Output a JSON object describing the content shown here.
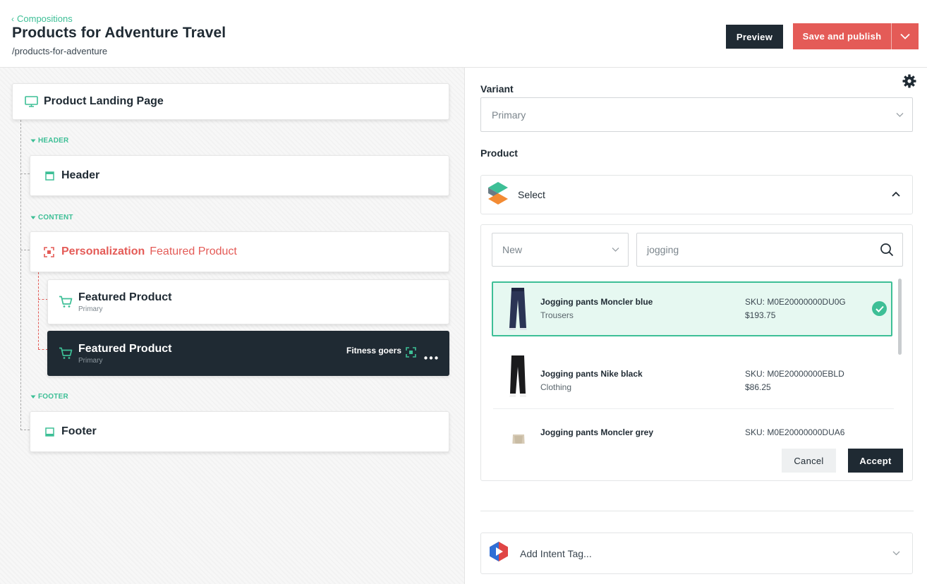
{
  "header": {
    "back_label": "Compositions",
    "title": "Products for Adventure Travel",
    "slug": "/products-for-adventure",
    "preview_label": "Preview",
    "publish_label": "Save and publish"
  },
  "tree": {
    "root": "Product Landing Page",
    "sections": {
      "header": "HEADER",
      "content": "CONTENT",
      "footer": "FOOTER"
    },
    "header_component": "Header",
    "personalization": {
      "label": "Personalization",
      "name": "Featured Product"
    },
    "variants": [
      {
        "title": "Featured Product",
        "sub": "Primary"
      },
      {
        "title": "Featured Product",
        "sub": "Primary",
        "audience": "Fitness goers"
      }
    ],
    "footer_component": "Footer"
  },
  "panel": {
    "variant_label": "Variant",
    "variant_value": "Primary",
    "product_label": "Product",
    "product_select_label": "Select",
    "filter_value": "New",
    "search_value": "jogging",
    "products": [
      {
        "name": "Jogging pants Moncler blue",
        "category": "Trousers",
        "sku": "SKU: M0E20000000DU0G",
        "price": "$193.75",
        "selected": true
      },
      {
        "name": "Jogging pants Nike black",
        "category": "Clothing",
        "sku": "SKU: M0E20000000EBLD",
        "price": "$86.25",
        "selected": false
      },
      {
        "name": "Jogging pants Moncler grey",
        "category": "",
        "sku": "SKU: M0E20000000DUA6",
        "price": "",
        "selected": false
      }
    ],
    "cancel_label": "Cancel",
    "accept_label": "Accept",
    "intent_label": "Add Intent Tag..."
  },
  "colors": {
    "accent_green": "#3dbf96",
    "accent_red": "#e45b57",
    "dark": "#1f2a33"
  }
}
